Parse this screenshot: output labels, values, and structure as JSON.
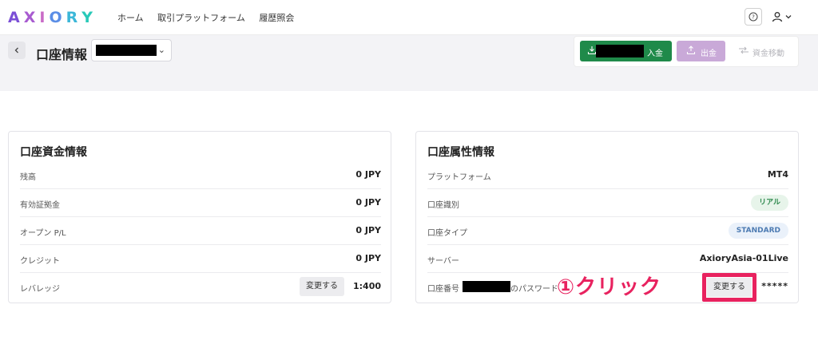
{
  "topnav": {
    "logo_letters": [
      "A",
      "X",
      "I",
      "O",
      "R",
      "Y"
    ],
    "links": [
      "ホーム",
      "取引プラットフォーム",
      "履歴照会"
    ],
    "help_icon": "question-circle-icon",
    "user_icon": "user-icon",
    "colors": {
      "logo_a": "#7b4fd6",
      "logo_x": "#a85bd0",
      "logo_i": "#c96bc7",
      "logo_o": "#5b8ee6",
      "logo_r": "#3cb7d8",
      "logo_y": "#29c9b8"
    }
  },
  "header": {
    "back_icon": "chevron-left-icon",
    "title": "口座情報",
    "account_chevron": "⌄",
    "deposit_label": "入金",
    "withdraw_label": "出金",
    "transfer_label": "資金移動",
    "colors": {
      "deposit": "#1f8a4a",
      "withdraw": "#c9a9d8"
    }
  },
  "funds_panel": {
    "title": "口座資金情報",
    "rows": [
      {
        "label": "残高",
        "value": "0 JPY"
      },
      {
        "label": "有効証拠金",
        "value": "0 JPY"
      },
      {
        "label": "オープン P/L",
        "value": "0 JPY"
      },
      {
        "label": "クレジット",
        "value": "0 JPY"
      },
      {
        "label": "レバレッジ",
        "value": "1:400",
        "button": "変更する"
      }
    ]
  },
  "attributes_panel": {
    "title": "口座属性情報",
    "rows": [
      {
        "label": "プラットフォーム",
        "value": "MT4"
      },
      {
        "label": "口座識別",
        "badge": "リアル"
      },
      {
        "label": "口座タイプ",
        "badge": "STANDARD"
      },
      {
        "label": "サーバー",
        "value": "AxioryAsia-01Live"
      },
      {
        "label_prefix": "口座番号",
        "label_suffix": "のパスワード",
        "value": "*****",
        "button": "変更する"
      }
    ]
  },
  "annotation": {
    "text": "①クリック",
    "color": "#e8225f"
  }
}
